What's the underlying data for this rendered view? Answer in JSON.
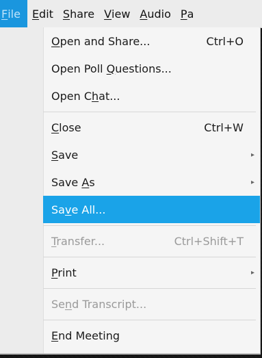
{
  "menubar": {
    "items": [
      {
        "label": "File",
        "mnemonic": "F",
        "active": true
      },
      {
        "label": "Edit",
        "mnemonic": "E"
      },
      {
        "label": "Share",
        "mnemonic": "S"
      },
      {
        "label": "View",
        "mnemonic": "V"
      },
      {
        "label": "Audio",
        "mnemonic": "A"
      },
      {
        "label": "Pa",
        "mnemonic": "P"
      }
    ]
  },
  "file_menu": {
    "items": [
      {
        "label": "Open and Share...",
        "mnemonic_index": 0,
        "shortcut": "Ctrl+O",
        "enabled": true
      },
      {
        "label": "Open Poll Questions...",
        "mnemonic_index": 10,
        "shortcut": "",
        "enabled": true
      },
      {
        "label": "Open Chat...",
        "mnemonic_index": 6,
        "shortcut": "",
        "enabled": true
      },
      {
        "label": "Close",
        "mnemonic_index": 0,
        "shortcut": "Ctrl+W",
        "enabled": true
      },
      {
        "label": "Save",
        "mnemonic_index": 0,
        "shortcut": "",
        "enabled": true,
        "submenu": true
      },
      {
        "label": "Save As",
        "mnemonic_index": 5,
        "shortcut": "",
        "enabled": true,
        "submenu": true
      },
      {
        "label": "Save All...",
        "mnemonic_index": 2,
        "shortcut": "",
        "enabled": true,
        "highlighted": true
      },
      {
        "label": "Transfer...",
        "mnemonic_index": 0,
        "shortcut": "Ctrl+Shift+T",
        "enabled": false
      },
      {
        "label": "Print",
        "mnemonic_index": 0,
        "shortcut": "",
        "enabled": true,
        "submenu": true
      },
      {
        "label": "Send Transcript...",
        "mnemonic_index": 2,
        "shortcut": "",
        "enabled": false
      },
      {
        "label": "End Meeting",
        "mnemonic_index": 0,
        "shortcut": "",
        "enabled": true
      }
    ]
  },
  "colors": {
    "highlight": "#1aa3e8",
    "active_menu": "#1a96de",
    "disabled_text": "#9a9a9a"
  },
  "icons": {
    "submenu_arrow": "submenu-arrow-icon"
  }
}
